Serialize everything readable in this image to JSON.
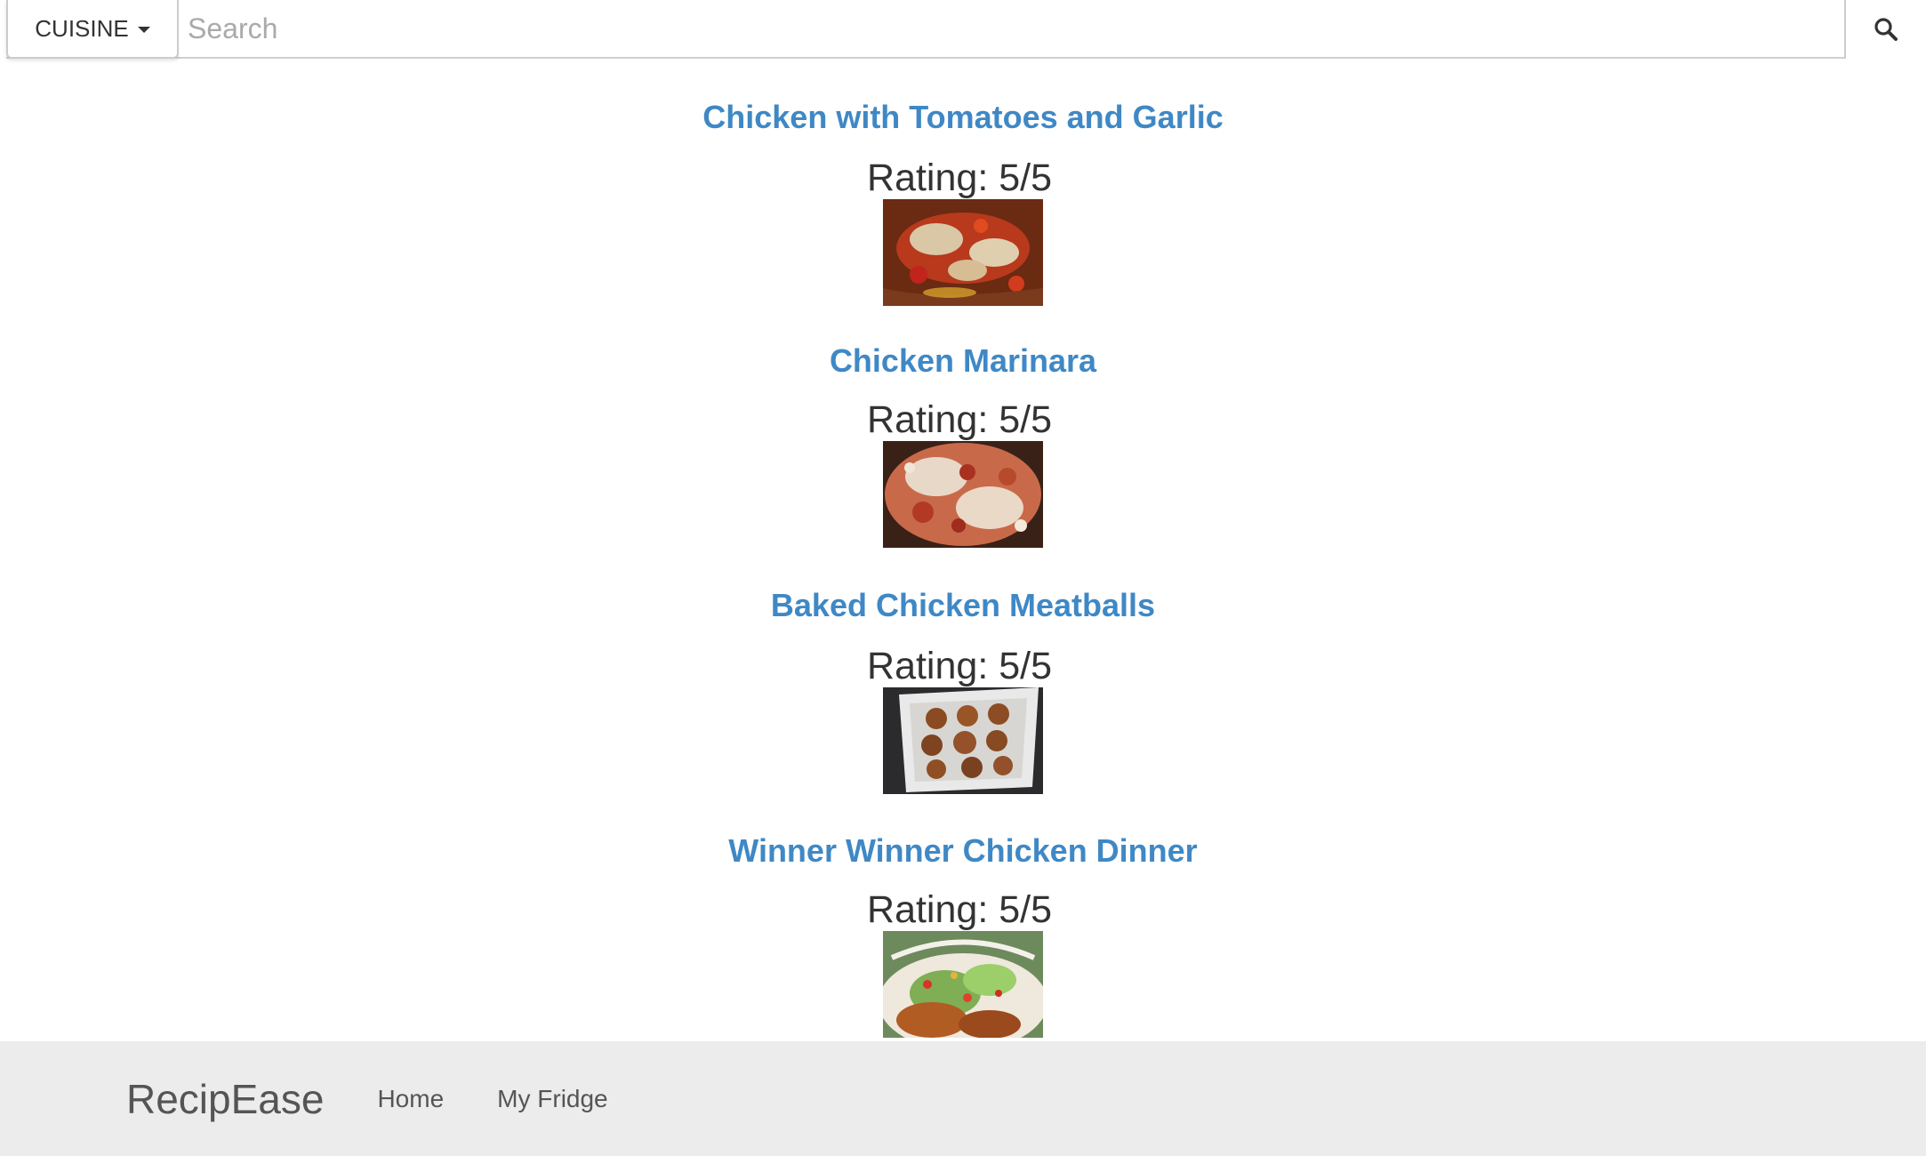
{
  "search": {
    "cuisine_label": "CUISINE",
    "placeholder": "Search",
    "value": ""
  },
  "recipes": [
    {
      "title": "Chicken with Tomatoes and Garlic",
      "rating": "Rating: 5/5",
      "image": "tomato-garlic-chicken-photo"
    },
    {
      "title": "Chicken Marinara",
      "rating": "Rating: 5/5",
      "image": "chicken-marinara-photo"
    },
    {
      "title": "Baked Chicken Meatballs",
      "rating": "Rating: 5/5",
      "image": "baked-meatballs-photo"
    },
    {
      "title": "Winner Winner Chicken Dinner",
      "rating": "Rating: 5/5",
      "image": "chicken-dinner-salad-photo"
    }
  ],
  "footer": {
    "brand": "RecipEase",
    "links": [
      "Home",
      "My Fridge"
    ]
  },
  "colors": {
    "link": "#3f88c5",
    "text": "#333333",
    "footer_bg": "#ececec"
  },
  "icons": {
    "search": "search-icon",
    "dropdown": "caret-down-icon"
  }
}
